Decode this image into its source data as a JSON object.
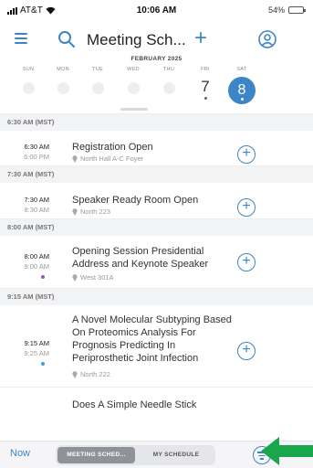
{
  "status": {
    "carrier": "AT&T",
    "time": "10:06 AM",
    "battery": "54%",
    "battery_level": 0.54
  },
  "header": {
    "title": "Meeting Sch..."
  },
  "calendar": {
    "month": "FEBRUARY 2025",
    "days": [
      {
        "name": "SUN",
        "num": ""
      },
      {
        "name": "MON",
        "num": ""
      },
      {
        "name": "TUE",
        "num": ""
      },
      {
        "name": "WED",
        "num": ""
      },
      {
        "name": "THU",
        "num": ""
      },
      {
        "name": "FRI",
        "num": "7"
      },
      {
        "name": "SAT",
        "num": "8"
      }
    ],
    "selected_day": "8"
  },
  "sections": [
    {
      "label": "6:30 AM (MST)"
    },
    {
      "label": "7:30 AM (MST)"
    },
    {
      "label": "8:00 AM (MST)"
    },
    {
      "label": "9:15 AM (MST)"
    }
  ],
  "events": [
    {
      "start": "6:30 AM",
      "end": "6:00 PM",
      "title": "Registration Open",
      "location": "North Hall A-C Foyer"
    },
    {
      "start": "7:30 AM",
      "end": "8:30 AM",
      "title": "Speaker Ready Room Open",
      "location": "North 223"
    },
    {
      "start": "8:00 AM",
      "end": "9:00 AM",
      "title": "Opening Session Presidential Address and Keynote Speaker",
      "location": "West 301A",
      "track_color": "#9b59b6"
    },
    {
      "start": "9:15 AM",
      "end": "9:25 AM",
      "title": "A Novel Molecular Subtyping Based On Proteomics Analysis For Prognosis Predicting In Periprosthetic Joint Infection",
      "location": "North 222",
      "track_color": "#3d9be9"
    },
    {
      "title": "Does A Simple Needle Stick"
    }
  ],
  "bottom": {
    "now": "Now",
    "tab_active": "MEETING SCHED...",
    "tab_other": "MY SCHEDULE"
  },
  "colors": {
    "accent": "#3d86c6",
    "annotation_arrow": "#1aa64a"
  }
}
